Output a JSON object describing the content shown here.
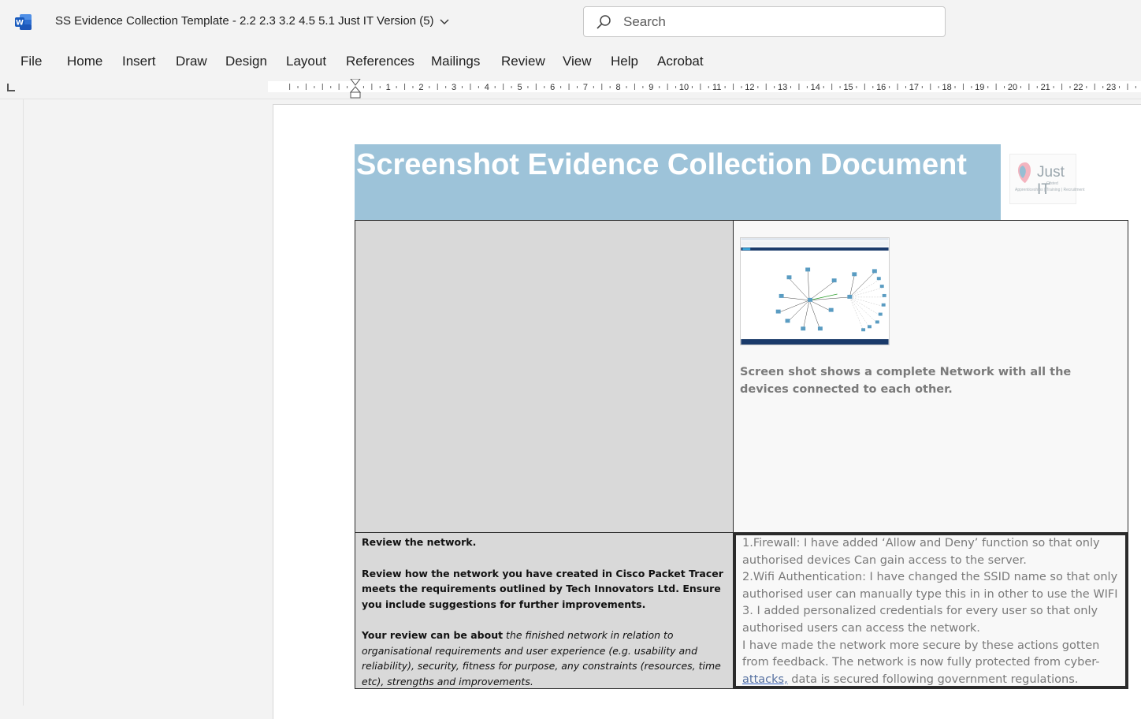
{
  "window": {
    "title": "SS Evidence Collection Template - 2.2 2.3 3.2 4.5 5.1 Just IT Version (5)",
    "app_icon": "word-icon"
  },
  "search": {
    "placeholder": "Search"
  },
  "menu": [
    "File",
    "Home",
    "Insert",
    "Draw",
    "Design",
    "Layout",
    "References",
    "Mailings",
    "Review",
    "View",
    "Help",
    "Acrobat"
  ],
  "ruler": {
    "numbers": [
      "1",
      "2",
      "3",
      "4",
      "5",
      "6",
      "7",
      "8",
      "9",
      "10",
      "11",
      "12",
      "13",
      "14",
      "15",
      "16",
      "17",
      "18",
      "19",
      "20",
      "21",
      "22",
      "23",
      "2"
    ]
  },
  "document": {
    "banner_title": "Screenshot Evidence Collection Document",
    "logo": {
      "text": "Just IT",
      "tagline": "Apprenticeships | Training | Recruitment",
      "sub": "Ofsted"
    },
    "screenshot_caption": "Screen shot shows a complete Network with all the devices connected to each other.",
    "review": {
      "heading": "Review the network.",
      "instruction": "Review how the network you have created in Cisco Packet Tracer meets the requirements outlined by Tech Innovators Ltd. Ensure you include suggestions for further improvements.",
      "about_lead": "Your review can be about",
      "about_rest": " the finished network in relation to organisational requirements and user experience (e.g. usability and reliability), security, fitness for purpose, any constraints (resources, time etc), strengths and improvements."
    },
    "answer": {
      "line1": "1.Firewall: I have added ‘Allow and Deny’ function so that only authorised devices Can gain access to the server.",
      "line2": "2.Wifi Authentication: I have changed the SSID name so that only authorised user can manually type this in in other to use the WIFI",
      "line3": "3. I added personalized credentials for every user so that only authorised users can access the network.",
      "line4_a": "I have made the network more secure by these actions gotten from feedback. The network is now fully protected from cyber-",
      "line4_link": "attacks,",
      "line4_b": " data is secured following government regulations."
    }
  },
  "colors": {
    "banner": "#9dc3d9",
    "cell_grey": "#d9d9d9",
    "caption_grey": "#7a7a7a"
  }
}
